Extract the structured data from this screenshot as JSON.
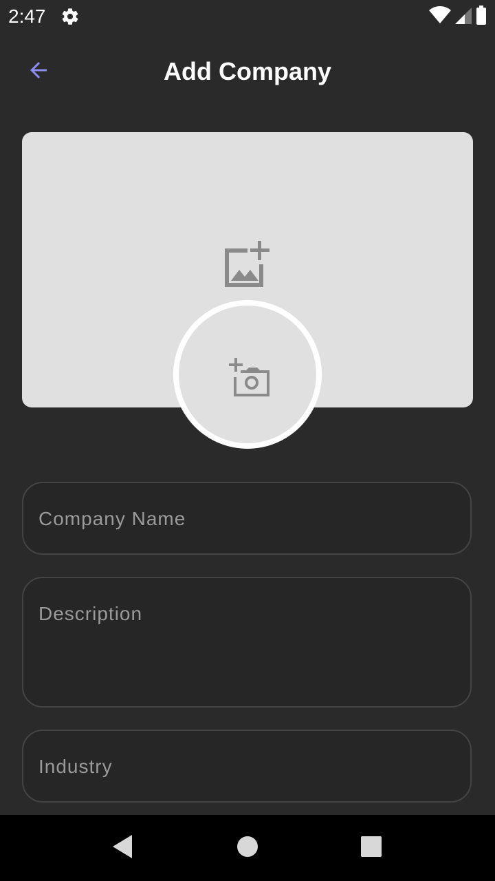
{
  "status_bar": {
    "time": "2:47",
    "icons": [
      "gear-icon",
      "wifi-icon",
      "signal-icon",
      "battery-icon"
    ]
  },
  "app_bar": {
    "title": "Add Company",
    "back_icon": "arrow-back-icon",
    "accent_color": "#8c8cf0"
  },
  "cover_image": {
    "icon": "add-photo-icon"
  },
  "avatar": {
    "icon": "add-a-photo-icon"
  },
  "form": {
    "company_name": {
      "value": "",
      "placeholder": "Company Name"
    },
    "description": {
      "value": "",
      "placeholder": "Description"
    },
    "industry": {
      "value": "",
      "placeholder": "Industry"
    }
  },
  "nav_bar": {
    "icons": [
      "nav-back-icon",
      "nav-home-icon",
      "nav-recents-icon"
    ]
  },
  "colors": {
    "background": "#2a2a2a",
    "placeholder_surface": "#e0e0e0",
    "field_border": "#444444",
    "icon_gray": "#8a8a8a"
  }
}
